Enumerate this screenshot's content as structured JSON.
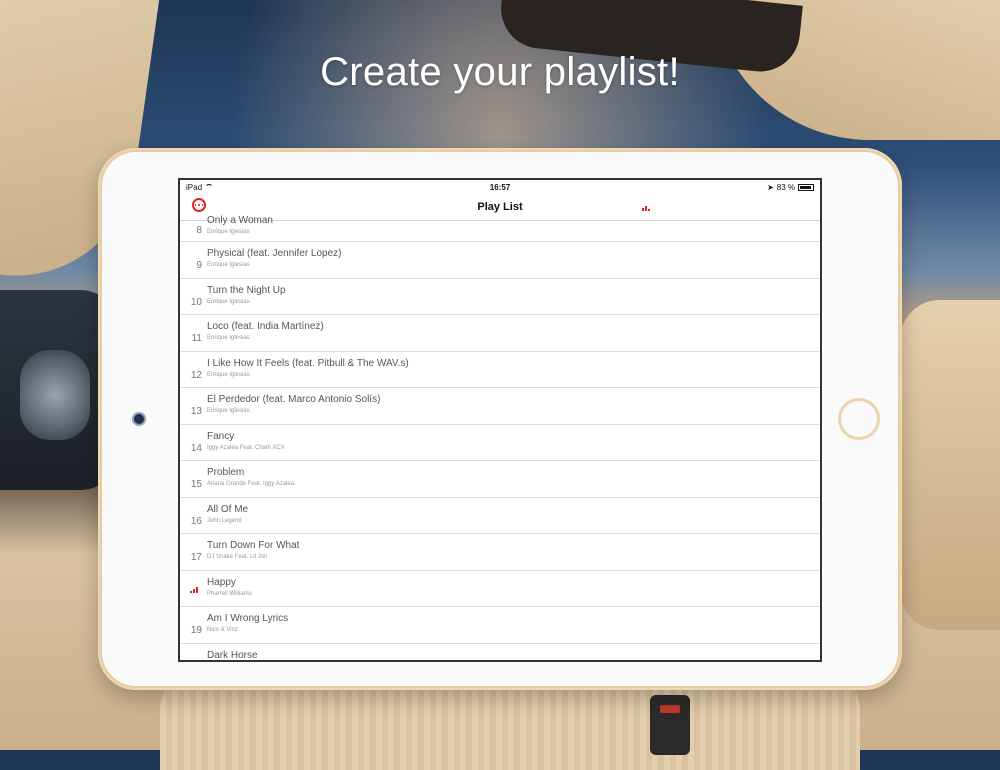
{
  "headline": "Create your playlist!",
  "status_bar": {
    "device": "iPad",
    "time": "16:57",
    "battery": "83 %"
  },
  "nav": {
    "title": "Play List"
  },
  "colors": {
    "accent": "#e02424"
  },
  "tracks": [
    {
      "num": "8",
      "title": "Only a Woman",
      "artist": "Enrique Iglesias"
    },
    {
      "num": "9",
      "title": "Physical (feat. Jennifer Lopez)",
      "artist": "Enrique Iglesias"
    },
    {
      "num": "10",
      "title": "Turn the Night Up",
      "artist": "Enrique Iglesias"
    },
    {
      "num": "11",
      "title": "Loco (feat. India Martínez)",
      "artist": "Enrique Iglesias"
    },
    {
      "num": "12",
      "title": "I Like How It Feels (feat. Pitbull & The WAV.s)",
      "artist": "Enrique Iglesias"
    },
    {
      "num": "13",
      "title": "El Perdedor (feat. Marco Antonio Solís)",
      "artist": "Enrique Iglesias"
    },
    {
      "num": "14",
      "title": "Fancy",
      "artist": "Iggy Azalea Feat. Charli XCX"
    },
    {
      "num": "15",
      "title": "Problem",
      "artist": "Ariana Grande Feat. Iggy Azalea"
    },
    {
      "num": "16",
      "title": "All Of Me",
      "artist": "John Legend"
    },
    {
      "num": "17",
      "title": "Turn Down For What",
      "artist": "DJ Snake Feat. Lil Jon"
    },
    {
      "num": "",
      "title": "Happy",
      "artist": "Pharrell Williams",
      "playing": true
    },
    {
      "num": "19",
      "title": "Am I Wrong Lyrics",
      "artist": "Nico & Vinz"
    },
    {
      "num": "20",
      "title": "Dark Horse",
      "artist": ""
    }
  ]
}
